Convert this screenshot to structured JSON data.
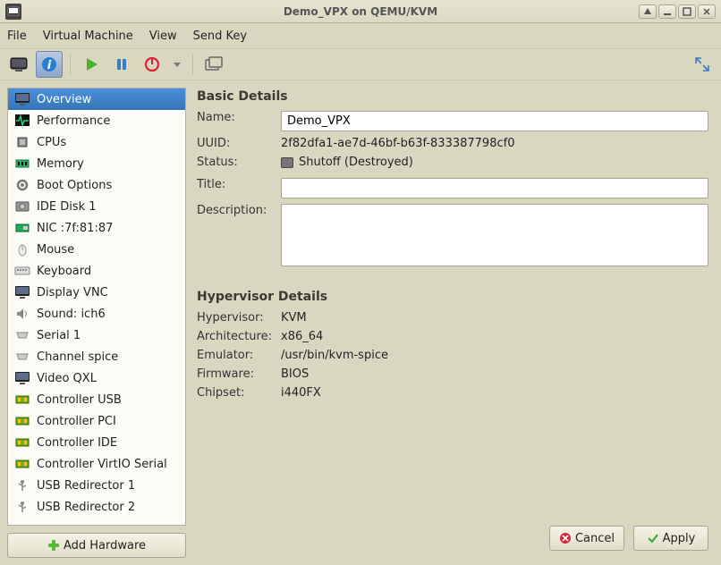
{
  "window": {
    "title": "Demo_VPX on QEMU/KVM"
  },
  "menu": {
    "file": "File",
    "vm": "Virtual Machine",
    "view": "View",
    "sendkey": "Send Key"
  },
  "sidebar": {
    "items": [
      {
        "label": "Overview"
      },
      {
        "label": "Performance"
      },
      {
        "label": "CPUs"
      },
      {
        "label": "Memory"
      },
      {
        "label": "Boot Options"
      },
      {
        "label": "IDE Disk 1"
      },
      {
        "label": "NIC :7f:81:87"
      },
      {
        "label": "Mouse"
      },
      {
        "label": "Keyboard"
      },
      {
        "label": "Display VNC"
      },
      {
        "label": "Sound: ich6"
      },
      {
        "label": "Serial 1"
      },
      {
        "label": "Channel spice"
      },
      {
        "label": "Video QXL"
      },
      {
        "label": "Controller USB"
      },
      {
        "label": "Controller PCI"
      },
      {
        "label": "Controller IDE"
      },
      {
        "label": "Controller VirtIO Serial"
      },
      {
        "label": "USB Redirector 1"
      },
      {
        "label": "USB Redirector 2"
      }
    ],
    "add_hw": "Add Hardware"
  },
  "basic": {
    "header": "Basic Details",
    "name_label": "Name:",
    "name_value": "Demo_VPX",
    "uuid_label": "UUID:",
    "uuid_value": "2f82dfa1-ae7d-46bf-b63f-833387798cf0",
    "status_label": "Status:",
    "status_value": "Shutoff (Destroyed)",
    "title_label": "Title:",
    "title_value": "",
    "desc_label": "Description:",
    "desc_value": ""
  },
  "hyp": {
    "header": "Hypervisor Details",
    "hv_label": "Hypervisor:",
    "hv_value": "KVM",
    "arch_label": "Architecture:",
    "arch_value": "x86_64",
    "emu_label": "Emulator:",
    "emu_value": "/usr/bin/kvm-spice",
    "fw_label": "Firmware:",
    "fw_value": "BIOS",
    "chipset_label": "Chipset:",
    "chipset_value": "i440FX"
  },
  "buttons": {
    "cancel": "Cancel",
    "apply": "Apply"
  }
}
